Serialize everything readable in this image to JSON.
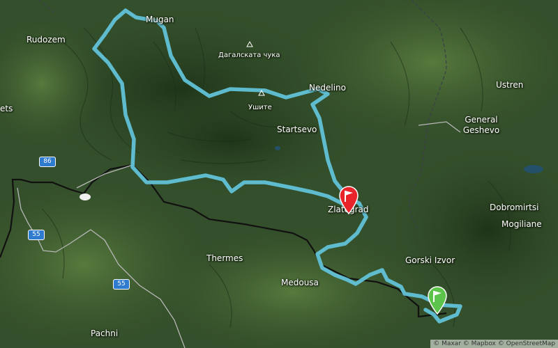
{
  "map": {
    "places": [
      {
        "name": "Mugan"
      },
      {
        "name": "Rudozem"
      },
      {
        "name": "Nedelino"
      },
      {
        "name": "Ustren"
      },
      {
        "name": "General Geshevo"
      },
      {
        "name": "Startsevo"
      },
      {
        "name": "Zlatograd"
      },
      {
        "name": "Dobromirtsi"
      },
      {
        "name": "Mogiliane"
      },
      {
        "name": "Gorski Izvor"
      },
      {
        "name": "Thermes"
      },
      {
        "name": "Medousa"
      },
      {
        "name": "Pachni"
      },
      {
        "name": "ets"
      }
    ],
    "peaks": [
      {
        "name": "Дагалската чука"
      },
      {
        "name": "Ушите"
      }
    ],
    "road_shields": [
      {
        "number": "86"
      },
      {
        "number": "55"
      },
      {
        "number": "55"
      }
    ],
    "markers": {
      "start": {
        "type": "flag",
        "color": "#e8232a"
      },
      "finish": {
        "type": "flag",
        "color": "#5cc44a"
      }
    },
    "route": {
      "color": "#63c6dc"
    },
    "attribution": "© Maxar © Mapbox © OpenStreetMap"
  }
}
